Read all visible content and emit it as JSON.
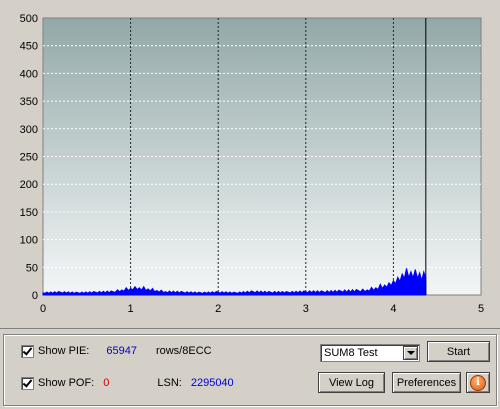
{
  "chart_data": {
    "type": "area",
    "xlim": [
      0,
      5
    ],
    "ylim": [
      0,
      500
    ],
    "x_ticks": [
      "0",
      "1",
      "2",
      "3",
      "4",
      "5"
    ],
    "y_ticks": [
      "0",
      "50",
      "100",
      "150",
      "200",
      "250",
      "300",
      "350",
      "400",
      "450",
      "500"
    ],
    "end_marker_x": 4.37,
    "series": [
      {
        "color": "#0000ff",
        "x": [
          0,
          0.2,
          0.4,
          0.6,
          0.8,
          0.9,
          1.0,
          1.05,
          1.1,
          1.2,
          1.3,
          1.4,
          1.6,
          1.8,
          2.0,
          2.2,
          2.4,
          2.6,
          2.8,
          3.0,
          3.2,
          3.4,
          3.6,
          3.7,
          3.8,
          3.9,
          3.95,
          4.0,
          4.05,
          4.1,
          4.15,
          4.2,
          4.25,
          4.3,
          4.37
        ],
        "y": [
          4,
          5,
          4,
          5,
          6,
          9,
          12,
          15,
          13,
          11,
          8,
          6,
          5,
          4,
          5,
          4,
          6,
          5,
          5,
          6,
          6,
          7,
          8,
          9,
          13,
          18,
          22,
          26,
          32,
          38,
          48,
          42,
          46,
          40,
          30
        ]
      }
    ],
    "grid": true
  },
  "controls": {
    "show_pie_label": "Show PIE:",
    "show_pie_value": "65947",
    "pie_unit": "rows/8ECC",
    "show_pof_label": "Show POF:",
    "show_pof_value": "0",
    "lsn_label": "LSN:",
    "lsn_value": "2295040",
    "test_select_value": "SUM8 Test",
    "start_label": "Start",
    "view_log_label": "View Log",
    "preferences_label": "Preferences",
    "info_glyph": "i"
  },
  "colors": {
    "value_blue": "#0000cc",
    "value_red": "#cc0000"
  }
}
